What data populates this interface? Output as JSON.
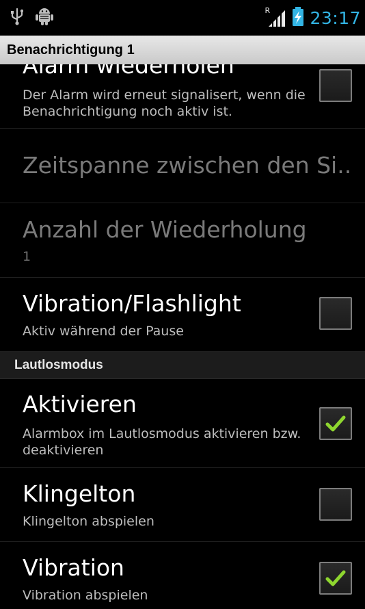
{
  "status_bar": {
    "time": "23:17",
    "icons": [
      "usb-icon",
      "android-debug-icon",
      "signal-roaming-icon",
      "battery-charging-icon"
    ],
    "roaming_indicator": "R",
    "time_color": "#33b5e5"
  },
  "title_bar": {
    "title": "Benachrichtigung 1"
  },
  "prefs": {
    "alarm_repeat": {
      "title": "Alarm wiederholen",
      "summary": "Der Alarm wird erneut signalisert, wenn die Benachrichtigung noch aktiv ist.",
      "checked": false
    },
    "interval": {
      "title": "Zeitspanne zwischen den Si..",
      "enabled": false
    },
    "repeat_count": {
      "title": "Anzahl der Wiederholung",
      "summary": "1",
      "enabled": false
    },
    "vibration_flashlight": {
      "title": "Vibration/Flashlight",
      "summary": "Aktiv während der Pause",
      "checked": false
    }
  },
  "silent_section": {
    "header": "Lautlosmodus",
    "activate": {
      "title": "Aktivieren",
      "summary": "Alarmbox im Lautlosmodus aktivieren bzw. deaktivieren",
      "checked": true
    },
    "ringtone": {
      "title": "Klingelton",
      "summary": "Klingelton abspielen",
      "checked": false
    },
    "vibration": {
      "title": "Vibration",
      "summary": "Vibration abspielen",
      "checked": true
    }
  },
  "colors": {
    "accent": "#33b5e5",
    "check": "#8ed62f",
    "background": "#000000"
  }
}
